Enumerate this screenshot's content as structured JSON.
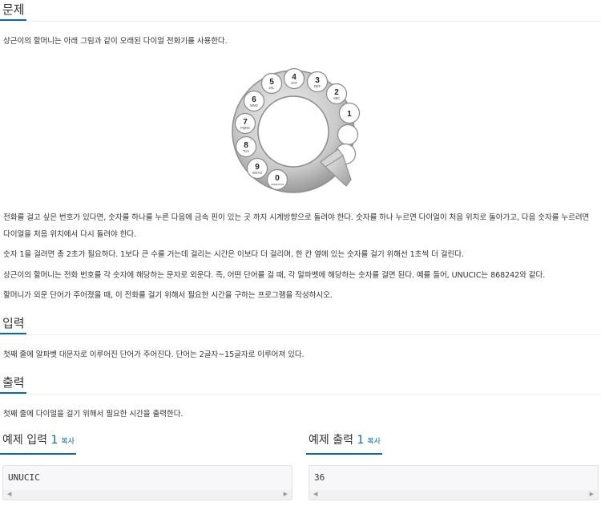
{
  "problem": {
    "heading": "문제",
    "para1": "상근이의 할머니는 아래 그림과 같이 오래된 다이얼 전화기를 사용한다.",
    "para2": "전화를 걸고 싶은 번호가 있다면, 숫자를 하나를 누른 다음에 금속 핀이 있는 곳 까지 시계방향으로 돌려야 한다. 숫자를 하나 누르면 다이얼이 처음 위치로 돌아가고, 다음 숫자를 누르려면 다이얼을 처음 위치에서 다시 돌려야 한다.",
    "para3": "숫자 1을 걸려면 총 2초가 필요하다. 1보다 큰 수를 거는데 걸리는 시간은 이보다 더 걸리며, 한 칸 옆에 있는 숫자를 걸기 위해선 1초씩 더 걸린다.",
    "para4": "상근이의 할머니는 전화 번호를 각 숫자에 해당하는 문자로 외운다. 즉, 어떤 단어를 걸 때, 각 알파벳에 해당하는 숫자를 걸면 된다. 예를 들어, UNUCIC는 868242와 같다.",
    "para5": "할머니가 외운 단어가 주어졌을 때, 이 전화를 걸기 위해서 필요한 시간을 구하는 프로그램을 작성하시오."
  },
  "dial": {
    "holes": [
      {
        "digit": "1",
        "letters": ""
      },
      {
        "digit": "2",
        "letters": "ABC"
      },
      {
        "digit": "3",
        "letters": "DEF"
      },
      {
        "digit": "4",
        "letters": "GHI"
      },
      {
        "digit": "5",
        "letters": "JKL"
      },
      {
        "digit": "6",
        "letters": "MNO"
      },
      {
        "digit": "7",
        "letters": "PQRS"
      },
      {
        "digit": "8",
        "letters": "TUV"
      },
      {
        "digit": "9",
        "letters": "WXYZ"
      },
      {
        "digit": "0",
        "letters": "OPERATOR"
      }
    ]
  },
  "input": {
    "heading": "입력",
    "text": "첫째 줄에 알파벳 대문자로 이루어진 단어가 주어진다. 단어는 2글자~15글자로 이루어져 있다."
  },
  "output": {
    "heading": "출력",
    "text": "첫째 줄에 다이얼을 걸기 위해서 필요한 시간을 출력한다."
  },
  "sample_input": {
    "label": "예제 입력",
    "number": "1",
    "copy": "복사",
    "value": "UNUCIC"
  },
  "sample_output": {
    "label": "예제 출력",
    "number": "1",
    "copy": "복사",
    "value": "36"
  }
}
